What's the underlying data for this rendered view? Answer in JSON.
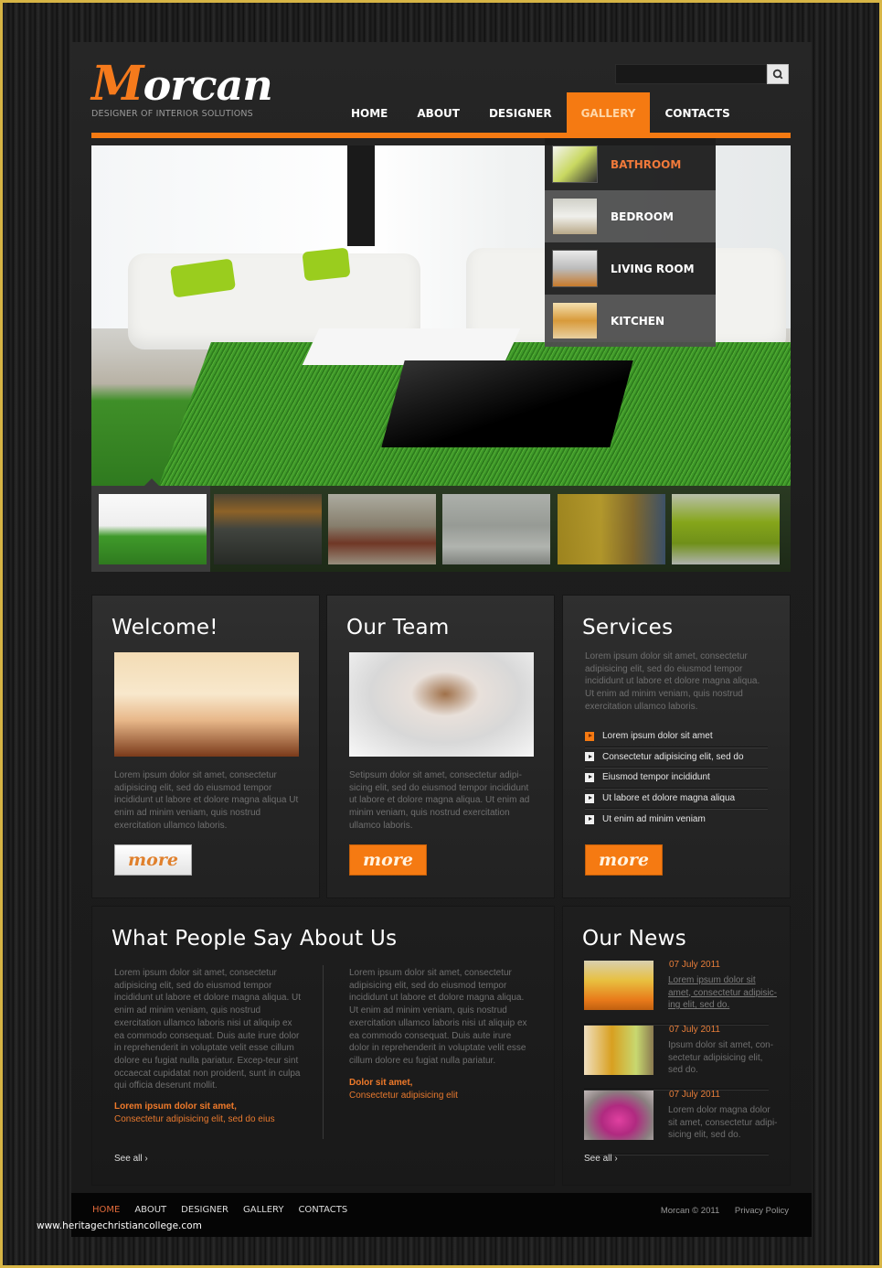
{
  "header": {
    "logo_first_letter": "M",
    "logo_rest": "orcan",
    "tagline": "DESIGNER OF INTERIOR SOLUTIONS",
    "search": {
      "value": "",
      "placeholder": "",
      "button_icon": "search-icon"
    }
  },
  "nav": {
    "items": [
      {
        "label": "HOME",
        "active": false
      },
      {
        "label": "ABOUT",
        "active": false
      },
      {
        "label": "DESIGNER",
        "active": false
      },
      {
        "label": "GALLERY",
        "active": true
      },
      {
        "label": "CONTACTS",
        "active": false
      }
    ]
  },
  "gallery_dropdown": {
    "items": [
      {
        "label": "BATHROOM",
        "active": true
      },
      {
        "label": "BEDROOM",
        "active": false
      },
      {
        "label": "LIVING ROOM",
        "active": false
      },
      {
        "label": "KITCHEN",
        "active": false
      }
    ]
  },
  "slider": {
    "selected_index": 0,
    "thumbnails": [
      {
        "name": "living-room-green-rug"
      },
      {
        "name": "dining-kitchen-orange"
      },
      {
        "name": "bedroom-brown"
      },
      {
        "name": "lounge-white"
      },
      {
        "name": "yellow-wall-living"
      },
      {
        "name": "green-kitchen"
      }
    ]
  },
  "welcome": {
    "title": "Welcome!",
    "text": "Lorem ipsum dolor sit amet, consectetur adipisicing elit, sed do eiusmod tempor incididunt ut labore et dolore magna aliqua Ut enim ad minim veniam, quis nostrud exercitation ullamco laboris.",
    "more_label": "more"
  },
  "team": {
    "title": "Our Team",
    "text": "Setipsum dolor sit amet, consectetur adipi-sicing elit, sed do eiusmod tempor incididunt ut labore et dolore magna aliqua. Ut enim ad minim veniam, quis nostrud exercitation ullamco laboris.",
    "more_label": "more"
  },
  "services": {
    "title": "Services",
    "text": "Lorem ipsum dolor sit amet, consectetur adipisicing elit, sed do eiusmod tempor incididunt ut labore et dolore magna aliqua. Ut enim ad minim veniam, quis nostrud exercitation ullamco laboris.",
    "items": [
      "Lorem ipsum dolor sit amet",
      "Consectetur adipisicing elit, sed do",
      "Eiusmod tempor incididunt",
      "Ut labore et dolore magna aliqua",
      "Ut enim ad minim veniam"
    ],
    "more_label": "more"
  },
  "testimonials": {
    "title": "What People Say About Us",
    "quotes": [
      {
        "text": "Lorem ipsum dolor sit amet, consectetur adipisicing elit, sed do eiusmod tempor incididunt ut labore et dolore magna aliqua. Ut enim ad minim veniam, quis nostrud exercitation ullamco laboris nisi ut aliquip ex ea commodo consequat. Duis aute irure dolor in reprehenderit in voluptate velit esse cillum dolore eu fugiat nulla pariatur. Excep-teur sint occaecat cupidatat non proident, sunt in culpa qui officia deserunt mollit.",
        "author": "Lorem ipsum dolor sit amet,",
        "role": "Consectetur adipisicing elit, sed do eius"
      },
      {
        "text": "Lorem ipsum dolor sit amet, consectetur adipisicing elit, sed do eiusmod tempor incididunt ut labore et dolore magna aliqua. Ut enim ad minim veniam, quis nostrud exercitation ullamco laboris nisi ut aliquip ex ea commodo consequat. Duis aute irure dolor in reprehenderit in voluptate velit esse cillum dolore eu fugiat nulla pariatur.",
        "author": "Dolor sit amet,",
        "role": "Consectetur adipisicing elit"
      }
    ],
    "see_all": "See all ›"
  },
  "news": {
    "title": "Our News",
    "items": [
      {
        "date": "07 July 2011",
        "text": "Lorem ipsum dolor sit amet, consectetur adipisic-ing elit, sed do.",
        "link": true
      },
      {
        "date": "07 July 2011",
        "text": "Ipsum dolor sit amet, con-sectetur adipisicing elit, sed do.",
        "link": false
      },
      {
        "date": "07 July 2011",
        "text": "Lorem dolor magna dolor sit amet, consectetur adipi-sicing elit, sed do.",
        "link": false
      }
    ],
    "see_all": "See all ›"
  },
  "footer": {
    "nav": [
      {
        "label": "HOME",
        "active": true
      },
      {
        "label": "ABOUT",
        "active": false
      },
      {
        "label": "DESIGNER",
        "active": false
      },
      {
        "label": "GALLERY",
        "active": false
      },
      {
        "label": "CONTACTS",
        "active": false
      }
    ],
    "copyright": "Morcan © 2011",
    "privacy": "Privacy Policy"
  },
  "watermark": "www.heritagechristiancollege.com",
  "colors": {
    "accent": "#f57a12",
    "frame": "#d7b545"
  }
}
